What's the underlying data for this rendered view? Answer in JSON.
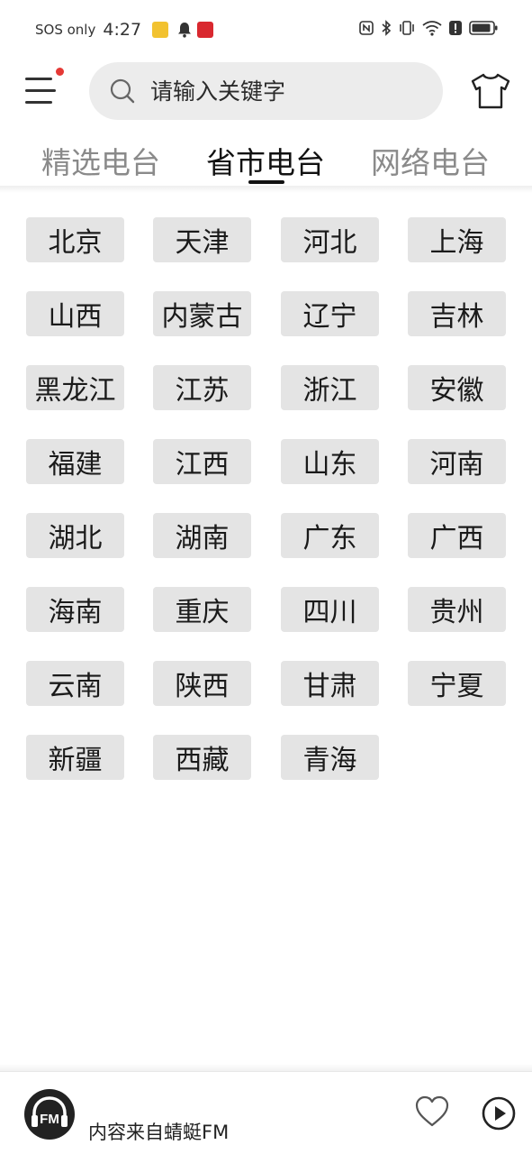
{
  "status_bar": {
    "carrier": "SOS only",
    "time": "4:27"
  },
  "header": {
    "menu_icon": "hamburger-menu-icon",
    "notification_dot_color": "#e53935",
    "search_placeholder": "请输入关键字",
    "skin_icon": "t-shirt-icon"
  },
  "tabs": [
    {
      "label": "精选电台",
      "active": false
    },
    {
      "label": "省市电台",
      "active": true
    },
    {
      "label": "网络电台",
      "active": false
    }
  ],
  "provinces": [
    "北京",
    "天津",
    "河北",
    "上海",
    "山西",
    "内蒙古",
    "辽宁",
    "吉林",
    "黑龙江",
    "江苏",
    "浙江",
    "安徽",
    "福建",
    "江西",
    "山东",
    "河南",
    "湖北",
    "湖南",
    "广东",
    "广西",
    "海南",
    "重庆",
    "四川",
    "贵州",
    "云南",
    "陕西",
    "甘肃",
    "宁夏",
    "新疆",
    "西藏",
    "青海"
  ],
  "player": {
    "logo_text": "FM",
    "source_text": "内容来自蜻蜓FM",
    "favorite_icon": "heart-icon",
    "play_icon": "play-icon"
  }
}
